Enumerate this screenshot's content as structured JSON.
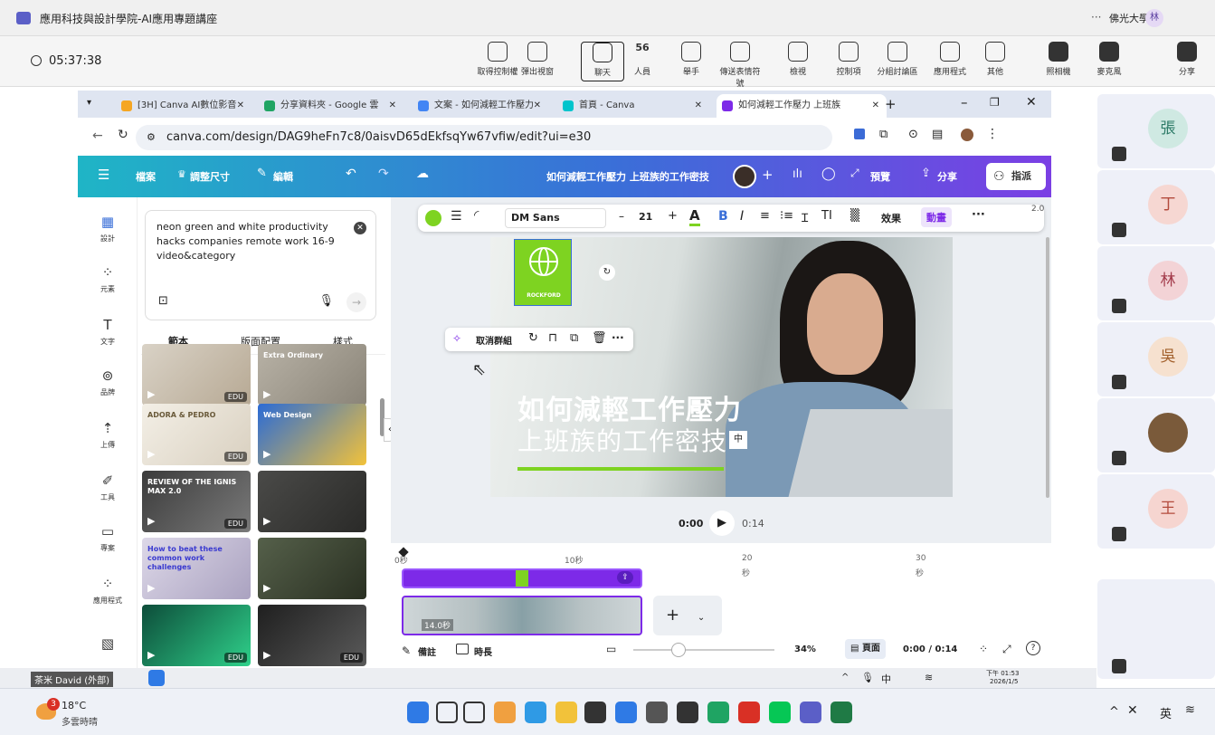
{
  "teams": {
    "title": "應用科技與設計學院-AI應用專題講座",
    "timer": "05:37:38",
    "org": "佛光大學",
    "user_initial": "林",
    "toolbar": [
      {
        "label": "取得控制權",
        "icon": "take-control-icon"
      },
      {
        "label": "彈出視窗",
        "icon": "popout-icon"
      },
      {
        "label": "聊天",
        "icon": "chat-icon"
      },
      {
        "label": "人員",
        "icon": "people-icon",
        "count": "56"
      },
      {
        "label": "舉手",
        "icon": "raise-hand-icon"
      },
      {
        "label": "傳送表情符號",
        "icon": "emoji-icon"
      },
      {
        "label": "檢視",
        "icon": "view-icon"
      },
      {
        "label": "控制項",
        "icon": "controls-icon"
      },
      {
        "label": "分組討論區",
        "icon": "breakout-icon"
      },
      {
        "label": "應用程式",
        "icon": "apps-icon"
      },
      {
        "label": "其他",
        "icon": "more-icon"
      },
      {
        "label": "照相機",
        "icon": "camera-off-icon"
      },
      {
        "label": "麥克風",
        "icon": "mic-off-icon"
      },
      {
        "label": "分享",
        "icon": "share-icon"
      }
    ]
  },
  "browser": {
    "tabs": [
      {
        "label": "[3H] Canva AI數位影音",
        "color": "#f5a623"
      },
      {
        "label": "分享資料夾 - Google 雲",
        "color": "#1fa463"
      },
      {
        "label": "文案 - 如何減輕工作壓力",
        "color": "#4285f4"
      },
      {
        "label": "首頁 - Canva",
        "color": "#00c4cc"
      },
      {
        "label": "如何減輕工作壓力 上班族",
        "color": "#7d2ae8"
      }
    ],
    "url": "canva.com/design/DAG9heFn7c8/0aisvD65dEkfsqYw67vfiw/edit?ui=e30"
  },
  "canva": {
    "menu": [
      "檔案",
      "調整尺寸",
      "編輯"
    ],
    "title": "如何減輕工作壓力 上班族的工作密技",
    "preview": "預覽",
    "share": "分享",
    "assign": "指派",
    "rail": [
      "設計",
      "元素",
      "文字",
      "品牌",
      "上傳",
      "工具",
      "專案",
      "應用程式"
    ],
    "prompt": "neon green and white productivity hacks companies remote work 16-9 video&category",
    "panel_tabs": [
      "範本",
      "版面配置",
      "樣式"
    ],
    "toolbar": {
      "font": "DM Sans",
      "size": "21",
      "effects": "效果",
      "animate": "動畫",
      "version": "2.0"
    },
    "selection_menu": "取消群組",
    "slide": {
      "logo_text": "ROCKFORD",
      "headline": "如何減輕工作壓力",
      "subline": "上班族的工作密技",
      "ime": "中"
    },
    "playback": {
      "current": "0:00",
      "total": "0:14"
    },
    "ruler": [
      "0秒",
      "10秒",
      "20",
      "秒",
      "30",
      "秒"
    ],
    "clip_duration": "14.0秒",
    "bottom": {
      "notes": "備註",
      "duration": "時長",
      "zoom": "34%",
      "pages": "頁面",
      "time": "0:00 / 0:14"
    },
    "thumb_labels": {
      "edu": "EDU",
      "extra": "Extra Ordinary",
      "adora": "ADORA & PEDRO",
      "web": "Web Design",
      "review": "REVIEW OF THE IGNIS MAX 2.0",
      "howto": "How to beat these common work challenges"
    }
  },
  "meeting": {
    "participants": [
      {
        "initial": "張",
        "color": "#cfe9e2",
        "text": "#2c7a66"
      },
      {
        "initial": "丁",
        "color": "#f6d7d2",
        "text": "#b34a3c"
      },
      {
        "initial": "林",
        "color": "#f3d3d6",
        "text": "#a33b4b"
      },
      {
        "initial": "吳",
        "color": "#f6e1cf",
        "text": "#a3612d"
      },
      {
        "initial": "",
        "color": "#7a5a3a",
        "text": "#fff"
      },
      {
        "initial": "王",
        "color": "#f6d5d0",
        "text": "#b34a3c"
      }
    ],
    "presenter_label": "茶米 David (外部)",
    "ime_chip": "中",
    "clock_time": "下午 01:53",
    "clock_date": "2026/1/5"
  },
  "taskbar": {
    "temp": "18°C",
    "weather": "多雲時晴",
    "badge": "3",
    "ime": "英"
  }
}
